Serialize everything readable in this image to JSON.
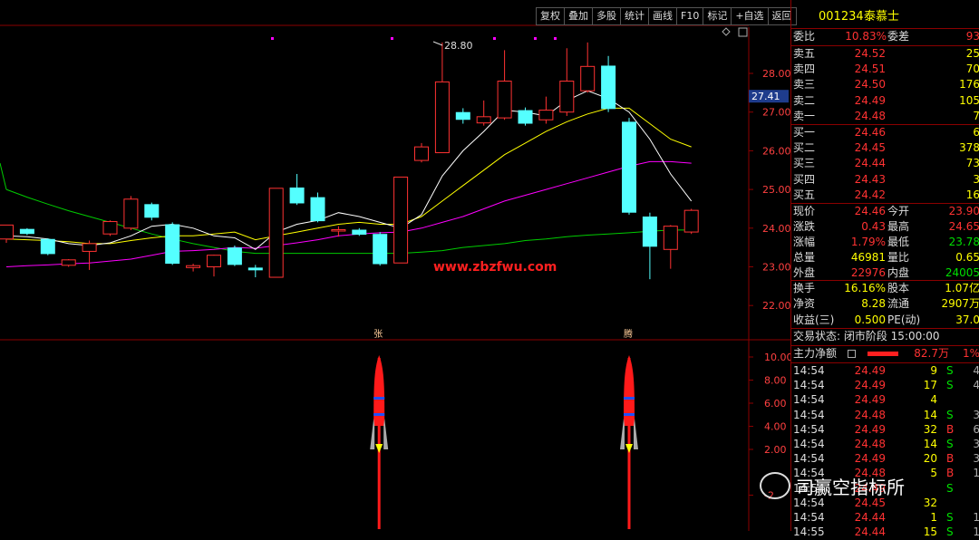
{
  "toolbar": [
    "复权",
    "叠加",
    "多股",
    "统计",
    "画线",
    "F10",
    "标记",
    "+自选",
    "返回"
  ],
  "stock": {
    "code": "001234",
    "name": "泰慕士"
  },
  "price_axis": {
    "ticks": [
      "28.00",
      "27.00",
      "26.00",
      "25.00",
      "24.00",
      "23.00",
      "22.00"
    ],
    "cursor_price": "27.41"
  },
  "chart": {
    "high_label": "28.80",
    "watermark": "www.zbzfwu.com",
    "signal_labels": [
      "张",
      "腾"
    ],
    "indicator_ticks": [
      "10.00",
      "8.00",
      "6.00",
      "4.00",
      "2.00",
      "-2"
    ],
    "colors": {
      "up": "#ff3232",
      "down": "#54ffff",
      "ma5": "#ffffff",
      "ma10": "#ffff00",
      "ma20": "#ff00ff",
      "ma60": "#00cc00"
    }
  },
  "chart_data": {
    "type": "candlestick",
    "candles": [
      {
        "o": 23.72,
        "c": 24.08,
        "h": 24.08,
        "l": 23.62
      },
      {
        "o": 23.98,
        "c": 23.85,
        "h": 24.0,
        "l": 23.82
      },
      {
        "o": 23.72,
        "c": 23.33,
        "h": 23.74,
        "l": 23.3
      },
      {
        "o": 23.04,
        "c": 23.18,
        "h": 23.2,
        "l": 23.0
      },
      {
        "o": 23.4,
        "c": 23.6,
        "h": 23.68,
        "l": 22.92
      },
      {
        "o": 23.85,
        "c": 24.17,
        "h": 24.2,
        "l": 23.8
      },
      {
        "o": 24.0,
        "c": 24.75,
        "h": 24.83,
        "l": 23.95
      },
      {
        "o": 24.62,
        "c": 24.27,
        "h": 24.66,
        "l": 24.2
      },
      {
        "o": 24.1,
        "c": 23.08,
        "h": 24.15,
        "l": 23.05
      },
      {
        "o": 22.98,
        "c": 23.03,
        "h": 23.08,
        "l": 22.88
      },
      {
        "o": 23.0,
        "c": 23.3,
        "h": 23.31,
        "l": 22.75
      },
      {
        "o": 23.5,
        "c": 23.05,
        "h": 23.55,
        "l": 23.02
      },
      {
        "o": 22.98,
        "c": 22.91,
        "h": 23.05,
        "l": 22.73
      },
      {
        "o": 22.73,
        "c": 25.03,
        "h": 25.03,
        "l": 22.73
      },
      {
        "o": 25.05,
        "c": 24.64,
        "h": 25.4,
        "l": 24.6
      },
      {
        "o": 24.8,
        "c": 24.18,
        "h": 24.92,
        "l": 24.15
      },
      {
        "o": 23.96,
        "c": 23.96,
        "h": 24.05,
        "l": 23.78
      },
      {
        "o": 23.96,
        "c": 23.83,
        "h": 24.0,
        "l": 23.8
      },
      {
        "o": 23.85,
        "c": 23.07,
        "h": 23.9,
        "l": 23.03
      },
      {
        "o": 23.1,
        "c": 25.32,
        "h": 25.32,
        "l": 23.1
      },
      {
        "o": 25.75,
        "c": 26.1,
        "h": 26.2,
        "l": 25.7
      },
      {
        "o": 25.95,
        "c": 27.78,
        "h": 28.8,
        "l": 25.95
      },
      {
        "o": 27.0,
        "c": 26.8,
        "h": 27.1,
        "l": 26.7
      },
      {
        "o": 26.72,
        "c": 26.88,
        "h": 27.3,
        "l": 26.65
      },
      {
        "o": 26.85,
        "c": 27.8,
        "h": 28.6,
        "l": 26.8
      },
      {
        "o": 27.05,
        "c": 26.7,
        "h": 27.12,
        "l": 26.65
      },
      {
        "o": 26.8,
        "c": 27.05,
        "h": 27.4,
        "l": 26.7
      },
      {
        "o": 27.0,
        "c": 27.8,
        "h": 28.65,
        "l": 26.9
      },
      {
        "o": 27.55,
        "c": 28.18,
        "h": 28.8,
        "l": 27.5
      },
      {
        "o": 28.2,
        "c": 27.08,
        "h": 28.45,
        "l": 27.0
      },
      {
        "o": 26.75,
        "c": 24.4,
        "h": 26.85,
        "l": 24.35
      },
      {
        "o": 24.3,
        "c": 23.52,
        "h": 24.4,
        "l": 22.68
      },
      {
        "o": 23.45,
        "c": 24.05,
        "h": 24.08,
        "l": 22.95
      },
      {
        "o": 23.9,
        "c": 24.46,
        "h": 24.5,
        "l": 23.85
      }
    ],
    "ma5": [
      23.8,
      23.78,
      23.72,
      23.6,
      23.55,
      23.62,
      23.8,
      24.05,
      24.1,
      24.0,
      23.8,
      23.75,
      23.45,
      23.9,
      24.1,
      24.2,
      24.4,
      24.3,
      24.15,
      24.0,
      24.35,
      25.35,
      26.0,
      26.5,
      27.05,
      27.0,
      26.9,
      27.3,
      27.55,
      27.35,
      27.0,
      26.3,
      25.4,
      24.7
    ],
    "ma10": [
      23.72,
      23.7,
      23.68,
      23.65,
      23.6,
      23.6,
      23.68,
      23.75,
      23.8,
      23.8,
      23.85,
      23.9,
      23.7,
      23.8,
      23.9,
      24.0,
      24.1,
      24.15,
      24.1,
      24.1,
      24.3,
      24.7,
      25.1,
      25.5,
      25.9,
      26.2,
      26.5,
      26.75,
      26.95,
      27.1,
      27.1,
      26.7,
      26.3,
      26.1
    ],
    "ma20": [
      23.0,
      23.03,
      23.05,
      23.08,
      23.1,
      23.15,
      23.2,
      23.3,
      23.4,
      23.42,
      23.45,
      23.5,
      23.48,
      23.55,
      23.62,
      23.7,
      23.8,
      23.85,
      23.88,
      23.9,
      24.0,
      24.15,
      24.3,
      24.5,
      24.7,
      24.85,
      25.0,
      25.15,
      25.3,
      25.45,
      25.6,
      25.72,
      25.72,
      25.68
    ],
    "ma60": [
      25.0,
      24.8,
      24.62,
      24.45,
      24.3,
      24.15,
      24.0,
      23.85,
      23.72,
      23.6,
      23.5,
      23.4,
      23.35,
      23.35,
      23.35,
      23.35,
      23.35,
      23.35,
      23.35,
      23.35,
      23.38,
      23.42,
      23.5,
      23.55,
      23.6,
      23.68,
      23.72,
      23.78,
      23.82,
      23.85,
      23.88,
      23.92,
      23.95,
      23.95
    ],
    "signals": [
      {
        "index": 18,
        "label": "张"
      },
      {
        "index": 30,
        "label": "腾"
      }
    ],
    "ylim": [
      21.9,
      28.9
    ]
  },
  "panel": {
    "weibi": {
      "label": "委比",
      "value": "10.83%",
      "label2": "委差",
      "value2": "93"
    },
    "sells": [
      {
        "label": "卖五",
        "price": "24.52",
        "vol": "25"
      },
      {
        "label": "卖四",
        "price": "24.51",
        "vol": "70"
      },
      {
        "label": "卖三",
        "price": "24.50",
        "vol": "176"
      },
      {
        "label": "卖二",
        "price": "24.49",
        "vol": "105"
      },
      {
        "label": "卖一",
        "price": "24.48",
        "vol": "7"
      }
    ],
    "buys": [
      {
        "label": "买一",
        "price": "24.46",
        "vol": "6"
      },
      {
        "label": "买二",
        "price": "24.45",
        "vol": "378"
      },
      {
        "label": "买三",
        "price": "24.44",
        "vol": "73"
      },
      {
        "label": "买四",
        "price": "24.43",
        "vol": "3"
      },
      {
        "label": "买五",
        "price": "24.42",
        "vol": "16"
      }
    ],
    "quote": [
      [
        "现价",
        "24.46",
        "今开",
        "23.90"
      ],
      [
        "涨跌",
        "0.43",
        "最高",
        "24.65"
      ],
      [
        "涨幅",
        "1.79%",
        "最低",
        "23.78"
      ],
      [
        "总量",
        "46981",
        "量比",
        "0.65"
      ],
      [
        "外盘",
        "22976",
        "内盘",
        "24005"
      ]
    ],
    "fin": [
      [
        "换手",
        "16.16%",
        "股本",
        "1.07亿"
      ],
      [
        "净资",
        "8.28",
        "流通",
        "2907万"
      ],
      [
        "收益(三)",
        "0.500",
        "PE(动)",
        "37.0"
      ]
    ],
    "status": "交易状态: 闭市阶段 15:00:00",
    "flow": {
      "label": "主力净额",
      "value": "82.7万",
      "pct": "1%"
    },
    "ticks": [
      [
        "14:54",
        "24.49",
        "9",
        "S",
        "4"
      ],
      [
        "14:54",
        "24.49",
        "17",
        "S",
        "4"
      ],
      [
        "14:54",
        "24.49",
        "4",
        "",
        ""
      ],
      [
        "14:54",
        "24.48",
        "14",
        "S",
        "3"
      ],
      [
        "14:54",
        "24.49",
        "32",
        "B",
        "6"
      ],
      [
        "14:54",
        "24.48",
        "14",
        "S",
        "3"
      ],
      [
        "14:54",
        "24.49",
        "20",
        "B",
        "3"
      ],
      [
        "14:54",
        "24.48",
        "5",
        "B",
        "1"
      ],
      [
        "14:54",
        "24.49",
        "",
        "S",
        ""
      ],
      [
        "14:54",
        "24.45",
        "32",
        "",
        ""
      ],
      [
        "14:54",
        "24.44",
        "1",
        "S",
        "1"
      ],
      [
        "14:55",
        "24.44",
        "15",
        "S",
        "1"
      ]
    ]
  },
  "wechat_watermark": "司赢空指标所"
}
